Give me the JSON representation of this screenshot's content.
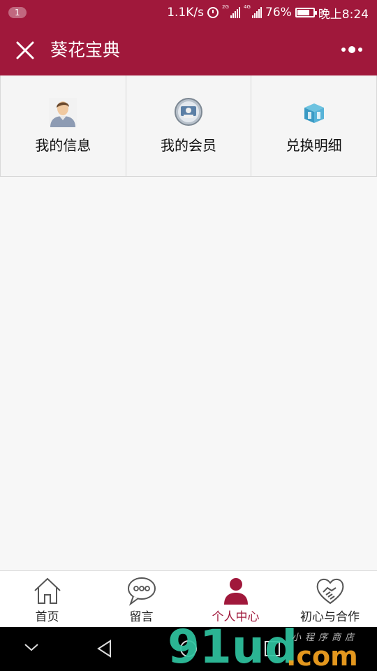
{
  "status_bar": {
    "notification_count": "1",
    "net_speed": "1.1K/s",
    "sim1_label": "2G",
    "sim2_label": "4G",
    "battery_percent": "76%",
    "battery_level": 0.76,
    "time": "晚上8:24"
  },
  "nav": {
    "title": "葵花宝典",
    "close_icon": "close-icon",
    "more_icon": "more-icon"
  },
  "menu": {
    "items": [
      {
        "label": "我的信息",
        "icon": "user-avatar-icon"
      },
      {
        "label": "我的会员",
        "icon": "member-badge-icon"
      },
      {
        "label": "兑换明细",
        "icon": "exchange-box-icon"
      }
    ]
  },
  "tabs": {
    "active_color": "#a0183b",
    "items": [
      {
        "label": "首页",
        "icon": "home-icon"
      },
      {
        "label": "留言",
        "icon": "chat-bubble-icon"
      },
      {
        "label": "个人中心",
        "icon": "person-icon",
        "active": true
      },
      {
        "label": "初心与合作",
        "icon": "handshake-icon"
      }
    ]
  },
  "watermark": {
    "brand": "91ud",
    "suffix": ".com",
    "tagline": "小程序商店"
  },
  "colors": {
    "brand": "#a0183b",
    "background": "#f7f7f7"
  }
}
